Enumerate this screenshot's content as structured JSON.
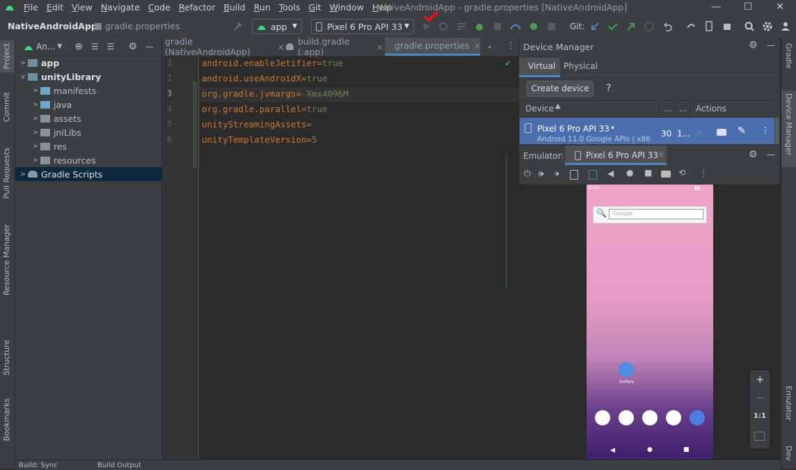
{
  "menu": [
    "File",
    "Edit",
    "View",
    "Navigate",
    "Code",
    "Refactor",
    "Build",
    "Run",
    "Tools",
    "Git",
    "Window",
    "Help"
  ],
  "window_title": "NativeAndroidApp - gradle.properties [NativeAndroidApp]",
  "breadcrumb": {
    "project": "NativeAndroidApp",
    "file": "gradle.properties"
  },
  "run_config": "app",
  "device_select": "Pixel 6 Pro API 33",
  "git_label": "Git:",
  "project_panel": {
    "view_label": "An...",
    "items": [
      {
        "label": "app",
        "level": 0,
        "expanded": false,
        "bold": true
      },
      {
        "label": "unityLibrary",
        "level": 0,
        "expanded": true,
        "bold": true
      },
      {
        "label": "manifests",
        "level": 1
      },
      {
        "label": "java",
        "level": 1
      },
      {
        "label": "assets",
        "level": 1
      },
      {
        "label": "jniLibs",
        "level": 1
      },
      {
        "label": "res",
        "level": 1
      },
      {
        "label": "resources",
        "level": 1
      },
      {
        "label": "Gradle Scripts",
        "level": 0,
        "selected": true
      }
    ]
  },
  "editor": {
    "tabs": [
      {
        "label": "gradle (NativeAndroidApp)"
      },
      {
        "label": "build.gradle (:app)"
      },
      {
        "label": "gradle.properties",
        "active": true
      }
    ],
    "lines": [
      {
        "n": "1",
        "key": "android.enableJetifier",
        "val": "true"
      },
      {
        "n": "2",
        "key": "android.useAndroidX",
        "val": "true"
      },
      {
        "n": "3",
        "key": "org.gradle.jvmargs",
        "val": "-Xmx4096M"
      },
      {
        "n": "4",
        "key": "org.gradle.parallel",
        "val": "true"
      },
      {
        "n": "5",
        "key": "unityStreamingAssets",
        "val": ""
      },
      {
        "n": "6",
        "key": "unityTemplateVersion",
        "val": "5"
      }
    ]
  },
  "device_manager": {
    "title": "Device Manager",
    "tabs": [
      "Virtual",
      "Physical"
    ],
    "create_button": "Create device",
    "help": "?",
    "columns": [
      "Device",
      "...",
      "...",
      "Actions"
    ],
    "device": {
      "name": "Pixel 6 Pro API 33",
      "detail": "Android 11.0 Google APIs | x86",
      "api": "30",
      "col2": "1..."
    }
  },
  "emulator": {
    "label": "Emulator:",
    "tab": "Pixel 6 Pro API 33",
    "zoom_ratio": "1:1",
    "time": "6:00",
    "search_placeholder": "Google",
    "app_label": "Gallery"
  },
  "left_strip": [
    "Project",
    "Commit",
    "Pull Requests",
    "Resource Manager",
    "Structure",
    "Bookmarks"
  ],
  "right_strip": [
    "Gradle",
    "Device Manager",
    "Emulator",
    "Dev"
  ],
  "bottom": {
    "left": "Build: Sync",
    "right": "Build Output"
  },
  "colors": {
    "accent": "#4a88c7",
    "selection": "#0d293e",
    "keyword": "#cc7832",
    "value": "#6a8759"
  }
}
